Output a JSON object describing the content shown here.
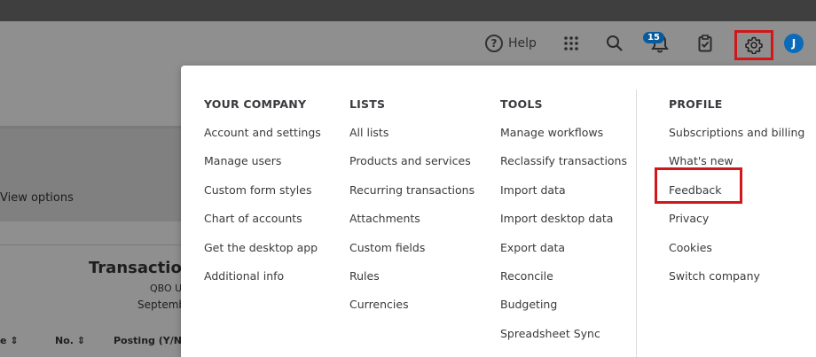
{
  "header": {
    "help_label": "Help",
    "notification_count": "15",
    "avatar_initial": "J"
  },
  "background": {
    "view_options": "View options",
    "report_title": "Transaction",
    "report_sub1": "QBO U",
    "report_sub2": "Septemb",
    "columns": [
      "e",
      "No.",
      "Posting (Y/N)"
    ]
  },
  "menu": {
    "your_company": {
      "heading": "YOUR COMPANY",
      "items": [
        "Account and settings",
        "Manage users",
        "Custom form styles",
        "Chart of accounts",
        "Get the desktop app",
        "Additional info"
      ]
    },
    "lists": {
      "heading": "LISTS",
      "items": [
        "All lists",
        "Products and services",
        "Recurring transactions",
        "Attachments",
        "Custom fields",
        "Rules",
        "Currencies"
      ]
    },
    "tools": {
      "heading": "TOOLS",
      "items": [
        "Manage workflows",
        "Reclassify transactions",
        "Import data",
        "Import desktop data",
        "Export data",
        "Reconcile",
        "Budgeting",
        "Spreadsheet Sync"
      ]
    },
    "profile": {
      "heading": "PROFILE",
      "items": [
        "Subscriptions and billing",
        "What's new",
        "Feedback",
        "Privacy",
        "Cookies",
        "Switch company"
      ]
    }
  },
  "colors": {
    "highlight": "#d0181b",
    "avatar": "#0d6ab8"
  }
}
